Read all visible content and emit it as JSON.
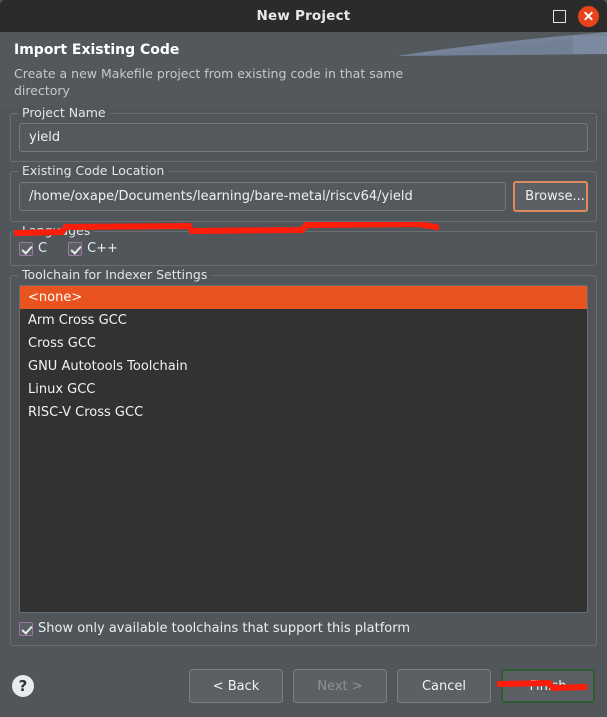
{
  "window": {
    "title": "New Project",
    "controls": {
      "maximize": "maximize-icon",
      "close": "close-icon"
    }
  },
  "header": {
    "title": "Import Existing Code",
    "description": "Create a new Makefile project from existing code in that same directory"
  },
  "project_name": {
    "group_label": "Project Name",
    "value": "yield",
    "placeholder": ""
  },
  "code_location": {
    "group_label": "Existing Code Location",
    "value": "/home/oxape/Documents/learning/bare-metal/riscv64/yield",
    "placeholder": "",
    "browse_label": "Browse..."
  },
  "languages": {
    "group_label": "Languages",
    "options": [
      {
        "label": "C",
        "checked": true
      },
      {
        "label": "C++",
        "checked": true
      }
    ]
  },
  "toolchain": {
    "group_label": "Toolchain for Indexer Settings",
    "items": [
      {
        "label": "<none>",
        "selected": true
      },
      {
        "label": "Arm Cross GCC",
        "selected": false
      },
      {
        "label": "Cross GCC",
        "selected": false
      },
      {
        "label": "GNU Autotools Toolchain",
        "selected": false
      },
      {
        "label": "Linux GCC",
        "selected": false
      },
      {
        "label": "RISC-V Cross GCC",
        "selected": false
      }
    ],
    "filter_label": "Show only available toolchains that support this platform",
    "filter_checked": true
  },
  "footer": {
    "help_glyph": "?",
    "buttons": [
      {
        "label": "< Back",
        "disabled": false,
        "focused": false
      },
      {
        "label": "Next >",
        "disabled": true,
        "focused": false
      },
      {
        "label": "Cancel",
        "disabled": false,
        "focused": false
      },
      {
        "label": "Finish",
        "disabled": false,
        "focused": true
      }
    ]
  },
  "colors": {
    "dialog_bg": "#51565a",
    "titlebar_bg": "#2b2b2b",
    "close_button": "#e8441c",
    "selection": "#e8531f",
    "annotation": "#fc1d0b",
    "focus_border": "#2f5c33",
    "browse_border": "#e08a5b",
    "checkbox_border": "#a174a8",
    "list_bg": "#323232"
  }
}
